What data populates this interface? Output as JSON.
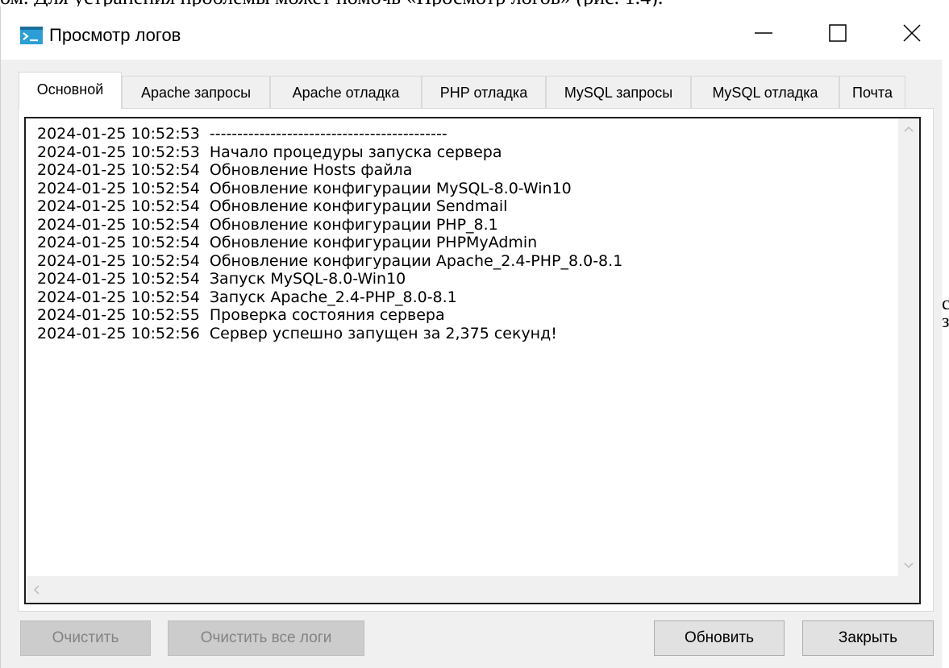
{
  "document": {
    "top_text": "ом. Для устранения проблемы может помочь «Просмотр логов» (рис. 1.4).",
    "right_edge_text": "с\nз"
  },
  "window": {
    "title": "Просмотр логов",
    "icon": "terminal-icon",
    "controls": {
      "minimize": "minimize-icon",
      "maximize": "maximize-icon",
      "close": "close-icon"
    }
  },
  "tabs": [
    {
      "label": "Основной",
      "active": true
    },
    {
      "label": "Apache запросы",
      "active": false
    },
    {
      "label": "Apache отладка",
      "active": false
    },
    {
      "label": "PHP отладка",
      "active": false
    },
    {
      "label": "MySQL запросы",
      "active": false
    },
    {
      "label": "MySQL отладка",
      "active": false
    },
    {
      "label": "Почта",
      "active": false
    }
  ],
  "log": {
    "lines": [
      "2024-01-25 10:52:53  -------------------------------------------",
      "2024-01-25 10:52:53  Начало процедуры запуска сервера",
      "2024-01-25 10:52:54  Обновление Hosts файла",
      "2024-01-25 10:52:54  Обновление конфигурации MySQL-8.0-Win10",
      "2024-01-25 10:52:54  Обновление конфигурации Sendmail",
      "2024-01-25 10:52:54  Обновление конфигурации PHP_8.1",
      "2024-01-25 10:52:54  Обновление конфигурации PHPMyAdmin",
      "2024-01-25 10:52:54  Обновление конфигурации Apache_2.4-PHP_8.0-8.1",
      "2024-01-25 10:52:54  Запуск MySQL-8.0-Win10",
      "2024-01-25 10:52:54  Запуск Apache_2.4-PHP_8.0-8.1",
      "2024-01-25 10:52:55  Проверка состояния сервера",
      "2024-01-25 10:52:56  Сервер успешно запущен за 2,375 секунд!"
    ]
  },
  "buttons": {
    "clear": {
      "label": "Очистить",
      "enabled": false
    },
    "clear_all": {
      "label": "Очистить все логи",
      "enabled": false
    },
    "refresh": {
      "label": "Обновить",
      "enabled": true
    },
    "close": {
      "label": "Закрыть",
      "enabled": true
    }
  },
  "colors": {
    "window_bg": "#f0f0f0",
    "icon_accent": "#2c9ed6",
    "border_dark": "#1e1e1e"
  }
}
